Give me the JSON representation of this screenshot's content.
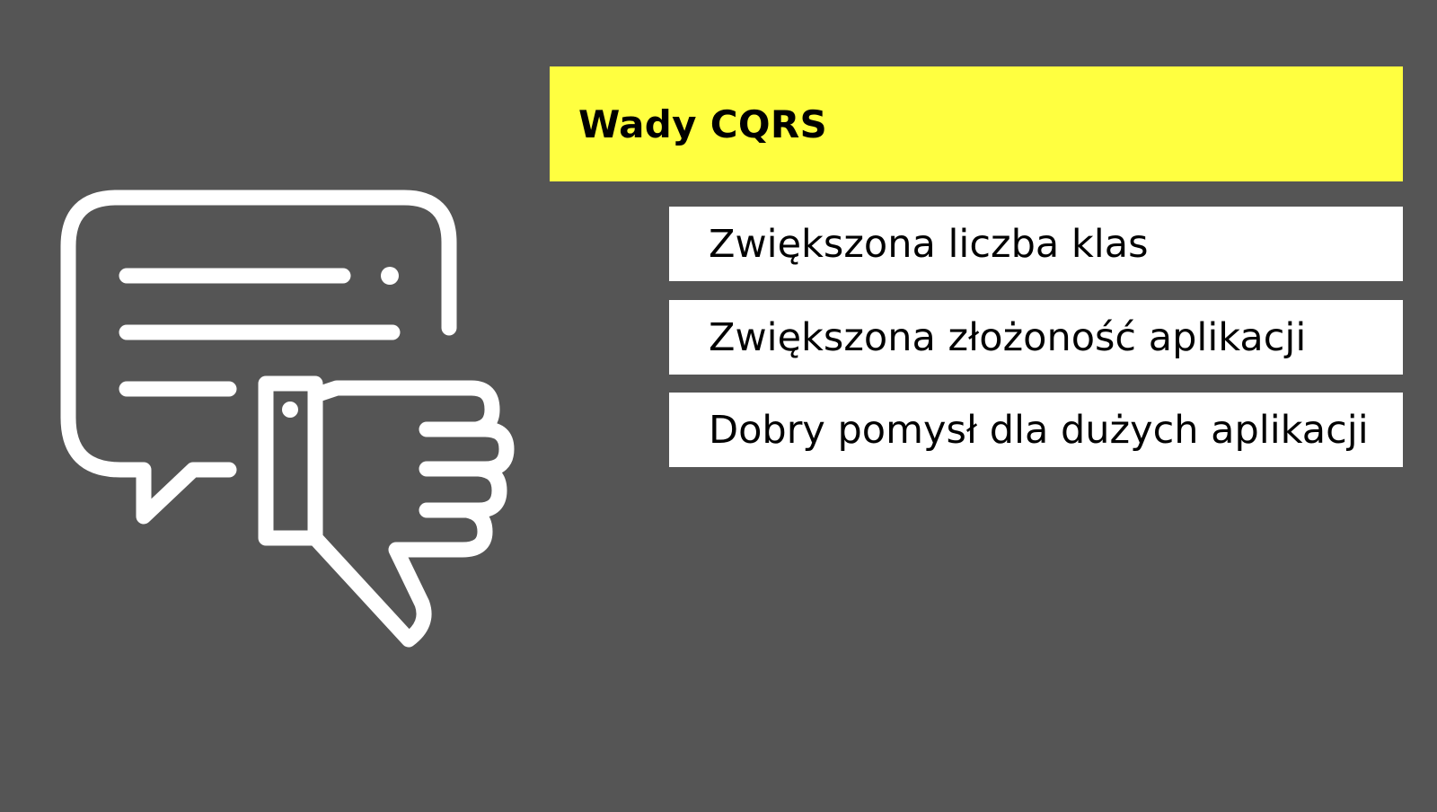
{
  "slide": {
    "title": "Wady CQRS",
    "items": [
      {
        "label": "Zwiększona liczba klas"
      },
      {
        "label": "Zwiększona złożoność aplikacji"
      },
      {
        "label": "Dobry pomysł dla dużych aplikacji"
      }
    ],
    "illustration": {
      "icon": "chat-bubble-thumbs-down-icon"
    }
  },
  "colors": {
    "background": "#555555",
    "title_banner": "#ffff40",
    "item_box": "#ffffff",
    "icon_stroke": "#ffffff",
    "text": "#000000"
  }
}
